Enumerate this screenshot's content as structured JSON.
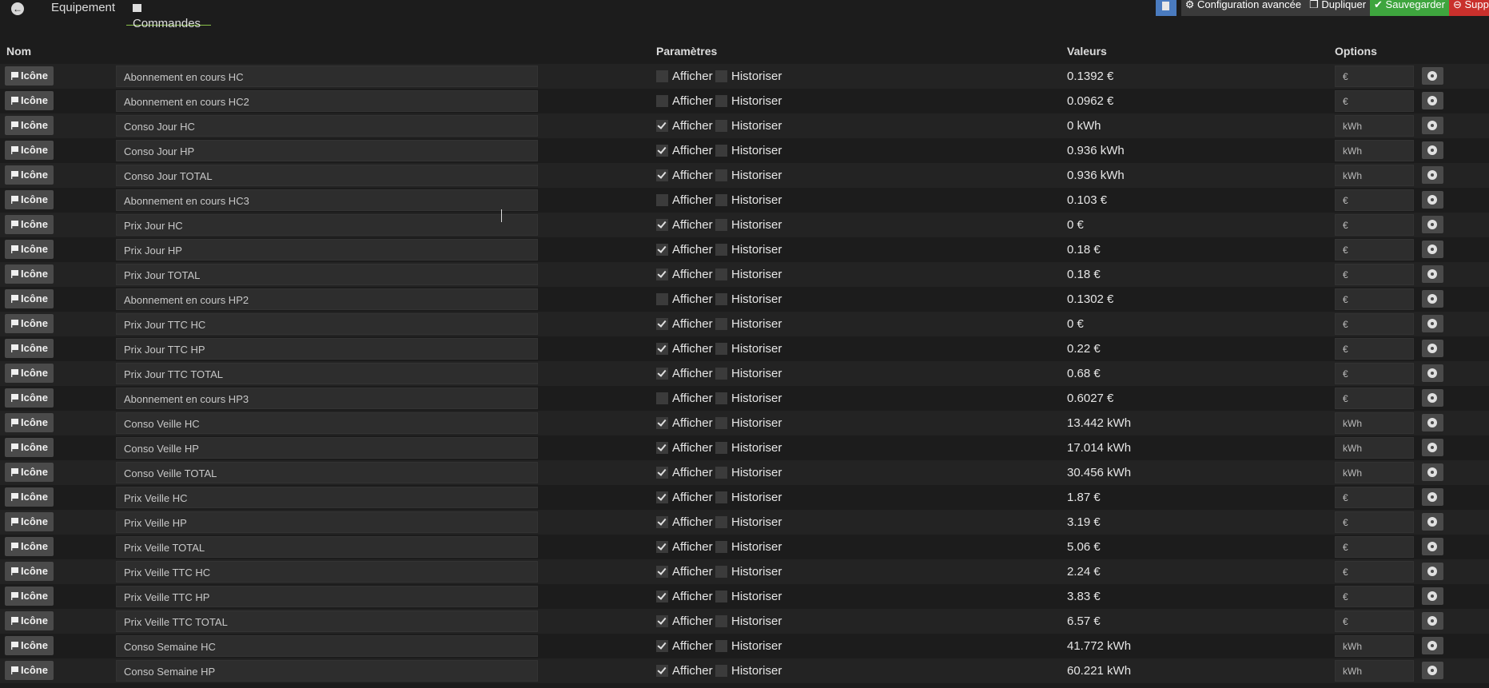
{
  "tabs": {
    "back_label": "",
    "equipement": "Equipement",
    "commandes": "Commandes"
  },
  "actions": {
    "config": "Configuration avancée",
    "dupliquer": "Dupliquer",
    "sauvegarder": "Sauvegarder",
    "supprimer": "Supprimer"
  },
  "headers": {
    "nom": "Nom",
    "parametres": "Paramètres",
    "valeurs": "Valeurs",
    "options": "Options"
  },
  "labels": {
    "icon_button": "Icône",
    "afficher": "Afficher",
    "historiser": "Historiser"
  },
  "colors": {
    "background": "#1c1c1c",
    "accent_tab": "#8bc34a",
    "save": "#3ea53e",
    "delete": "#c9302c",
    "doc": "#4a7bbf"
  },
  "commands": [
    {
      "name": "Abonnement en cours HC",
      "afficher": false,
      "historiser": false,
      "value": "0.1392 €",
      "unit": "€"
    },
    {
      "name": "Abonnement en cours HC2",
      "afficher": false,
      "historiser": false,
      "value": "0.0962 €",
      "unit": "€"
    },
    {
      "name": "Conso Jour HC",
      "afficher": true,
      "historiser": false,
      "value": "0 kWh",
      "unit": "kWh"
    },
    {
      "name": "Conso Jour HP",
      "afficher": true,
      "historiser": false,
      "value": "0.936 kWh",
      "unit": "kWh"
    },
    {
      "name": "Conso Jour TOTAL",
      "afficher": true,
      "historiser": false,
      "value": "0.936 kWh",
      "unit": "kWh"
    },
    {
      "name": "Abonnement en cours HC3",
      "afficher": false,
      "historiser": false,
      "value": "0.103 €",
      "unit": "€"
    },
    {
      "name": "Prix Jour HC",
      "afficher": true,
      "historiser": false,
      "value": "0 €",
      "unit": "€"
    },
    {
      "name": "Prix Jour HP",
      "afficher": true,
      "historiser": false,
      "value": "0.18 €",
      "unit": "€"
    },
    {
      "name": "Prix Jour TOTAL",
      "afficher": true,
      "historiser": false,
      "value": "0.18 €",
      "unit": "€"
    },
    {
      "name": "Abonnement en cours HP2",
      "afficher": false,
      "historiser": false,
      "value": "0.1302 €",
      "unit": "€"
    },
    {
      "name": "Prix Jour TTC HC",
      "afficher": true,
      "historiser": false,
      "value": "0 €",
      "unit": "€"
    },
    {
      "name": "Prix Jour TTC HP",
      "afficher": true,
      "historiser": false,
      "value": "0.22 €",
      "unit": "€"
    },
    {
      "name": "Prix Jour TTC TOTAL",
      "afficher": true,
      "historiser": false,
      "value": "0.68 €",
      "unit": "€"
    },
    {
      "name": "Abonnement en cours HP3",
      "afficher": false,
      "historiser": false,
      "value": "0.6027 €",
      "unit": "€"
    },
    {
      "name": "Conso Veille HC",
      "afficher": true,
      "historiser": false,
      "value": "13.442 kWh",
      "unit": "kWh"
    },
    {
      "name": "Conso Veille HP",
      "afficher": true,
      "historiser": false,
      "value": "17.014 kWh",
      "unit": "kWh"
    },
    {
      "name": "Conso Veille TOTAL",
      "afficher": true,
      "historiser": false,
      "value": "30.456 kWh",
      "unit": "kWh"
    },
    {
      "name": "Prix Veille HC",
      "afficher": true,
      "historiser": false,
      "value": "1.87 €",
      "unit": "€"
    },
    {
      "name": "Prix Veille HP",
      "afficher": true,
      "historiser": false,
      "value": "3.19 €",
      "unit": "€"
    },
    {
      "name": "Prix Veille TOTAL",
      "afficher": true,
      "historiser": false,
      "value": "5.06 €",
      "unit": "€"
    },
    {
      "name": "Prix Veille TTC HC",
      "afficher": true,
      "historiser": false,
      "value": "2.24 €",
      "unit": "€"
    },
    {
      "name": "Prix Veille TTC HP",
      "afficher": true,
      "historiser": false,
      "value": "3.83 €",
      "unit": "€"
    },
    {
      "name": "Prix Veille TTC TOTAL",
      "afficher": true,
      "historiser": false,
      "value": "6.57 €",
      "unit": "€"
    },
    {
      "name": "Conso Semaine HC",
      "afficher": true,
      "historiser": false,
      "value": "41.772 kWh",
      "unit": "kWh"
    },
    {
      "name": "Conso Semaine HP",
      "afficher": true,
      "historiser": false,
      "value": "60.221 kWh",
      "unit": "kWh"
    }
  ]
}
